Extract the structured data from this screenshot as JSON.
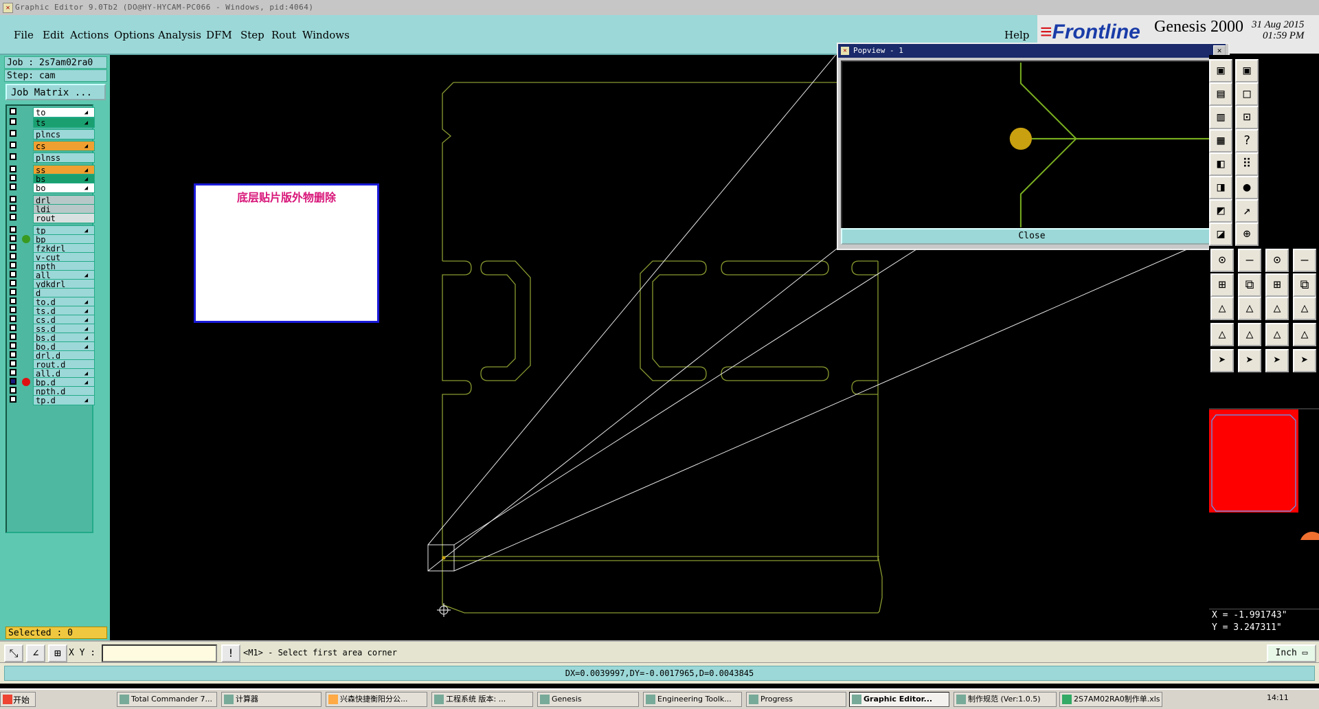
{
  "window": {
    "title": "Graphic Editor 9.0Tb2 (DO@HY-HYCAM-PC066 - Windows, pid:4064)"
  },
  "menu": {
    "items": [
      "File",
      "Edit",
      "Actions",
      "Options",
      "Analysis",
      "DFM",
      "Step",
      "Rout",
      "Windows"
    ],
    "help": "Help"
  },
  "brand": {
    "logo": "Frontline",
    "product": "Genesis 2000",
    "date": "31 Aug 2015",
    "time": "01:59 PM"
  },
  "job": {
    "job_line": "Job : 2s7am02ra0",
    "step_line": "Step: cam",
    "matrix_button": "Job Matrix ...",
    "selected": "Selected : 0"
  },
  "layers": [
    {
      "name": "to",
      "color": "#ffffff",
      "arrow": true
    },
    {
      "name": "ts",
      "color": "#1aa070",
      "arrow": true
    },
    {
      "name": "plncs",
      "color": "#9cd8d8",
      "arrow": false
    },
    {
      "name": "cs",
      "color": "#f0a030",
      "arrow": true
    },
    {
      "name": "plnss",
      "color": "#9cd8d8",
      "arrow": false
    },
    {
      "name": "ss",
      "color": "#f0a030",
      "arrow": true
    },
    {
      "name": "bs",
      "color": "#1aa070",
      "arrow": true
    },
    {
      "name": "bo",
      "color": "#ffffff",
      "arrow": true
    },
    {
      "name": "drl",
      "color": "#b8c8c8",
      "arrow": false
    },
    {
      "name": "ldi",
      "color": "#b8c8c8",
      "arrow": false
    },
    {
      "name": "rout",
      "color": "#d8e0e0",
      "arrow": false
    },
    {
      "name": "tp",
      "color": "#9cd8d8",
      "arrow": true
    },
    {
      "name": "bp",
      "color": "#9cd8d8",
      "arrow": false,
      "dot": "#3a9a20"
    },
    {
      "name": "fzkdrl",
      "color": "#9cd8d8",
      "arrow": false
    },
    {
      "name": "v-cut",
      "color": "#9cd8d8",
      "arrow": false
    },
    {
      "name": "npth",
      "color": "#9cd8d8",
      "arrow": false
    },
    {
      "name": "all",
      "color": "#9cd8d8",
      "arrow": true
    },
    {
      "name": "ydkdrl",
      "color": "#9cd8d8",
      "arrow": false
    },
    {
      "name": "d",
      "color": "#9cd8d8",
      "arrow": false
    },
    {
      "name": "to.d",
      "color": "#9cd8d8",
      "arrow": true
    },
    {
      "name": "ts.d",
      "color": "#9cd8d8",
      "arrow": true
    },
    {
      "name": "cs.d",
      "color": "#9cd8d8",
      "arrow": true
    },
    {
      "name": "ss.d",
      "color": "#9cd8d8",
      "arrow": true
    },
    {
      "name": "bs.d",
      "color": "#9cd8d8",
      "arrow": true
    },
    {
      "name": "bo.d",
      "color": "#9cd8d8",
      "arrow": true
    },
    {
      "name": "drl.d",
      "color": "#9cd8d8",
      "arrow": false
    },
    {
      "name": "rout.d",
      "color": "#9cd8d8",
      "arrow": false
    },
    {
      "name": "all.d",
      "color": "#9cd8d8",
      "arrow": true
    },
    {
      "name": "bp.d",
      "color": "#9cd8d8",
      "arrow": true,
      "dot": "#e01010",
      "checked": true
    },
    {
      "name": "npth.d",
      "color": "#9cd8d8",
      "arrow": false
    },
    {
      "name": "tp.d",
      "color": "#9cd8d8",
      "arrow": true
    }
  ],
  "note": {
    "text": "底层贴片版外物删除"
  },
  "popview": {
    "title": "Popview - 1",
    "close_button": "Close"
  },
  "coordinates": {
    "x": "X = -1.991743\"",
    "y": "Y = 3.247311\""
  },
  "command": {
    "xy_label": "X Y :",
    "xy_value": "",
    "prompt": "<M1> - Select first area corner",
    "unit": "Inch"
  },
  "status": {
    "measure": "DX=0.0039997,DY=-0.0017965,D=0.0043845"
  },
  "taskbar": {
    "start": "开始",
    "items": [
      "Total Commander 7...",
      "计算器",
      "兴森快捷衡阳分公...",
      "工程系统   版本: ...",
      "Genesis",
      "Engineering Toolk...",
      "Progress",
      "Graphic Editor...",
      "制作规范 (Ver:1.0.5)",
      "2S7AM02RA0制作单.xls"
    ],
    "clock": "14:11"
  },
  "colors": {
    "outline": "#8a9a30",
    "minimap_fill": "#ff0000",
    "pad": "#c8a010"
  }
}
